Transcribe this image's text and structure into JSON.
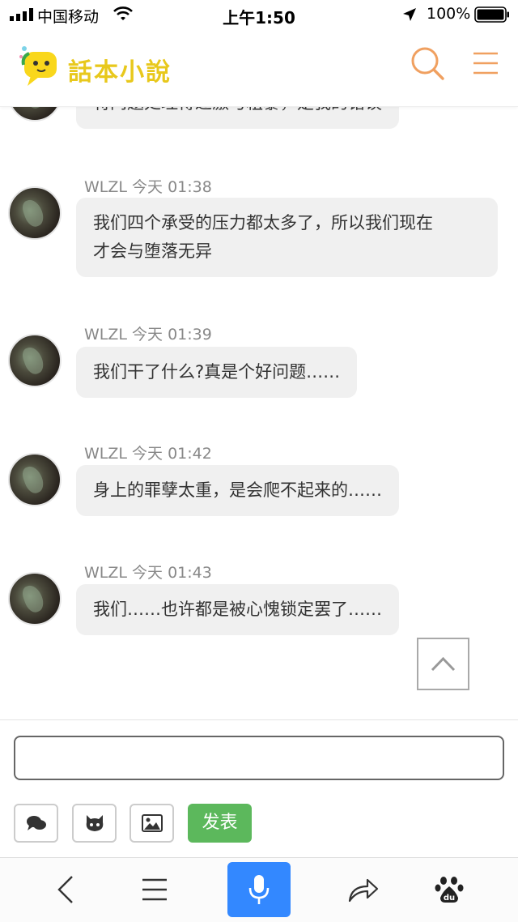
{
  "status_bar": {
    "carrier": "中国移动",
    "time": "上午1:50",
    "battery": "100%"
  },
  "header": {
    "logo_text": "話本小說",
    "icons": [
      "search-icon",
      "menu-icon"
    ],
    "accent_color": "#f0a060"
  },
  "messages": [
    {
      "author": "",
      "time": "",
      "text": "将问题处理得过激与粗暴，是我的错误"
    },
    {
      "author": "WLZL",
      "time": "今天 01:38",
      "text": "我们四个承受的压力都太多了，所以我们现在\n才会与堕落无异"
    },
    {
      "author": "WLZL",
      "time": "今天 01:39",
      "text": "我们干了什么?真是个好问题……"
    },
    {
      "author": "WLZL",
      "time": "今天 01:42",
      "text": "身上的罪孽太重，是会爬不起来的……"
    },
    {
      "author": "WLZL",
      "time": "今天 01:43",
      "text": "我们……也许都是被心愧锁定罢了……"
    }
  ],
  "comment": {
    "input_value": "",
    "input_placeholder": "",
    "publish_label": "发表",
    "tool_icons": [
      "chat-bubble-icon",
      "github-icon",
      "image-icon"
    ],
    "publish_color": "#5cb85c"
  },
  "bottom_nav": {
    "icons": [
      "back-arrow-icon",
      "menu-icon",
      "microphone-icon",
      "share-icon",
      "baidu-icon"
    ],
    "mic_color": "#3388ff"
  }
}
